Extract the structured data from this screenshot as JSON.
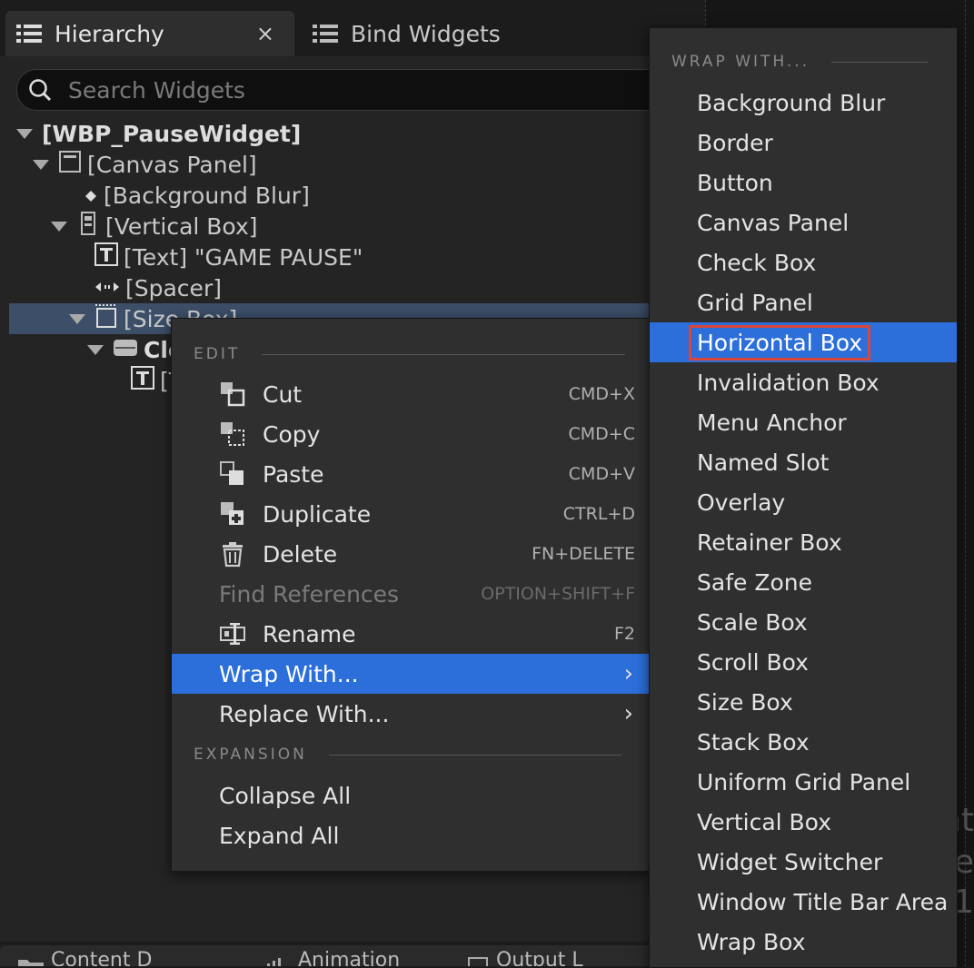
{
  "tabs": [
    {
      "label": "Hierarchy",
      "icon": "list-icon",
      "close": "×"
    },
    {
      "label": "Bind Widgets",
      "icon": "list-icon"
    }
  ],
  "search": {
    "placeholder": "Search Widgets"
  },
  "tree": [
    {
      "label": "[WBP_PauseWidget]",
      "icon": "none",
      "expanded": true
    },
    {
      "label": "[Canvas Panel]",
      "icon": "canvas-panel-icon",
      "expanded": true
    },
    {
      "label": "[Background Blur]",
      "icon": "dot-icon"
    },
    {
      "label": "[Vertical Box]",
      "icon": "vertical-box-icon",
      "expanded": true
    },
    {
      "label": "[Text] \"GAME PAUSE\"",
      "icon": "text-icon"
    },
    {
      "label": "[Spacer]",
      "icon": "spacer-icon"
    },
    {
      "label": "[Size Box]",
      "icon": "size-box-icon",
      "expanded": true,
      "selected": true
    },
    {
      "label": "Cle",
      "icon": "button-icon",
      "expanded": true
    },
    {
      "label": "[T",
      "icon": "text-icon"
    }
  ],
  "bottom_tabs": [
    {
      "label": "Content D"
    },
    {
      "label": "Animation"
    },
    {
      "label": "Output L"
    }
  ],
  "context_menu": {
    "section_edit": "EDIT",
    "items": [
      {
        "label": "Cut",
        "shortcut": "CMD+X",
        "icon": "cut-icon"
      },
      {
        "label": "Copy",
        "shortcut": "CMD+C",
        "icon": "copy-icon"
      },
      {
        "label": "Paste",
        "shortcut": "CMD+V",
        "icon": "paste-icon"
      },
      {
        "label": "Duplicate",
        "shortcut": "CTRL+D",
        "icon": "duplicate-icon"
      },
      {
        "label": "Delete",
        "shortcut": "FN+DELETE",
        "icon": "trash-icon"
      },
      {
        "label": "Find References",
        "shortcut": "OPTION+SHIFT+F",
        "disabled": true
      },
      {
        "label": "Rename",
        "shortcut": "F2",
        "icon": "rename-icon"
      },
      {
        "label": "Wrap With...",
        "submenu": true,
        "active": true
      },
      {
        "label": "Replace With...",
        "submenu": true
      }
    ],
    "section_expansion": "EXPANSION",
    "expansion_items": [
      {
        "label": "Collapse All"
      },
      {
        "label": "Expand All"
      }
    ]
  },
  "submenu": {
    "section": "WRAP WITH...",
    "items": [
      "Background Blur",
      "Border",
      "Button",
      "Canvas Panel",
      "Check Box",
      "Grid Panel",
      "Horizontal Box",
      "Invalidation Box",
      "Menu Anchor",
      "Named Slot",
      "Overlay",
      "Retainer Box",
      "Safe Zone",
      "Scale Box",
      "Scroll Box",
      "Size Box",
      "Stack Box",
      "Uniform Grid Panel",
      "Vertical Box",
      "Widget Switcher",
      "Window Title Bar Area",
      "Wrap Box"
    ],
    "highlighted": "Horizontal Box"
  },
  "background_text": [
    "nt",
    "fe",
    "1"
  ],
  "colors": {
    "accent": "#2c6fdb",
    "highlight_outline": "#d9453a",
    "selected_row": "#3c4e68"
  }
}
